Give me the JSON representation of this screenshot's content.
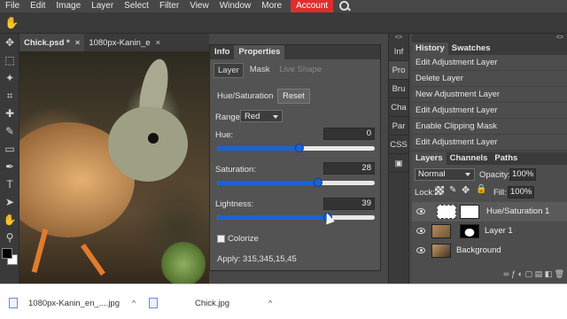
{
  "menu": {
    "items": [
      "File",
      "Edit",
      "Image",
      "Layer",
      "Select",
      "Filter",
      "View",
      "Window",
      "More"
    ],
    "account": "Account"
  },
  "toolbar": {
    "tools": [
      "hand-tool-icon",
      "marquee-tool-icon",
      "lasso-tool-icon",
      "magic-wand-tool-icon",
      "crop-tool-icon",
      "healing-tool-icon",
      "brush-tool-icon",
      "gradient-tool-icon",
      "pen-tool-icon",
      "type-tool-icon",
      "path-select-tool-icon",
      "hand-icon",
      "zoom-tool-icon"
    ]
  },
  "doc_tabs": [
    {
      "label": "Chick.psd *",
      "close": "×"
    },
    {
      "label": "1080px-Kanin_e",
      "close": "×"
    }
  ],
  "properties": {
    "tabs": [
      "Info",
      "Properties"
    ],
    "subtabs": [
      "Layer",
      "Mask",
      "Live Shape"
    ],
    "adjustment_title": "Hue/Saturation",
    "reset": "Reset",
    "range_label": "Range:",
    "range_value": "Red",
    "hue_label": "Hue:",
    "hue_value": "0",
    "saturation_label": "Saturation:",
    "saturation_value": "28",
    "lightness_label": "Lightness:",
    "lightness_value": "39",
    "colorize_label": "Colorize",
    "apply_text": "Apply: 315,345,15,45",
    "sliders": {
      "hue": 0.52,
      "saturation": 0.64,
      "lightness": 0.7
    },
    "accent": "#1b62d6"
  },
  "collapsed_panels": [
    "Inf",
    "Pro",
    "Bru",
    "Cha",
    "Par",
    "CSS"
  ],
  "history": {
    "tabs": [
      "History",
      "Swatches"
    ],
    "items": [
      "Edit Adjustment Layer",
      "Delete Layer",
      "New Adjustment Layer",
      "Edit Adjustment Layer",
      "Enable Clipping Mask",
      "Edit Adjustment Layer"
    ]
  },
  "layers": {
    "tabs": [
      "Layers",
      "Channels",
      "Paths"
    ],
    "blend_mode": "Normal",
    "opacity_label": "Opacity:",
    "opacity_value": "100%",
    "lock_label": "Lock:",
    "fill_label": "Fill:",
    "fill_value": "100%",
    "items": [
      "Hue/Saturation 1",
      "Layer 1",
      "Background"
    ],
    "bottom_icons": "∞  ƒ  ◐  ▢  ▤  ◧  🗑"
  },
  "downloads": [
    {
      "name": "1080px-Kanin_en_....jpg",
      "chev": "^"
    },
    {
      "name": "Chick.jpg",
      "chev": "^"
    }
  ]
}
